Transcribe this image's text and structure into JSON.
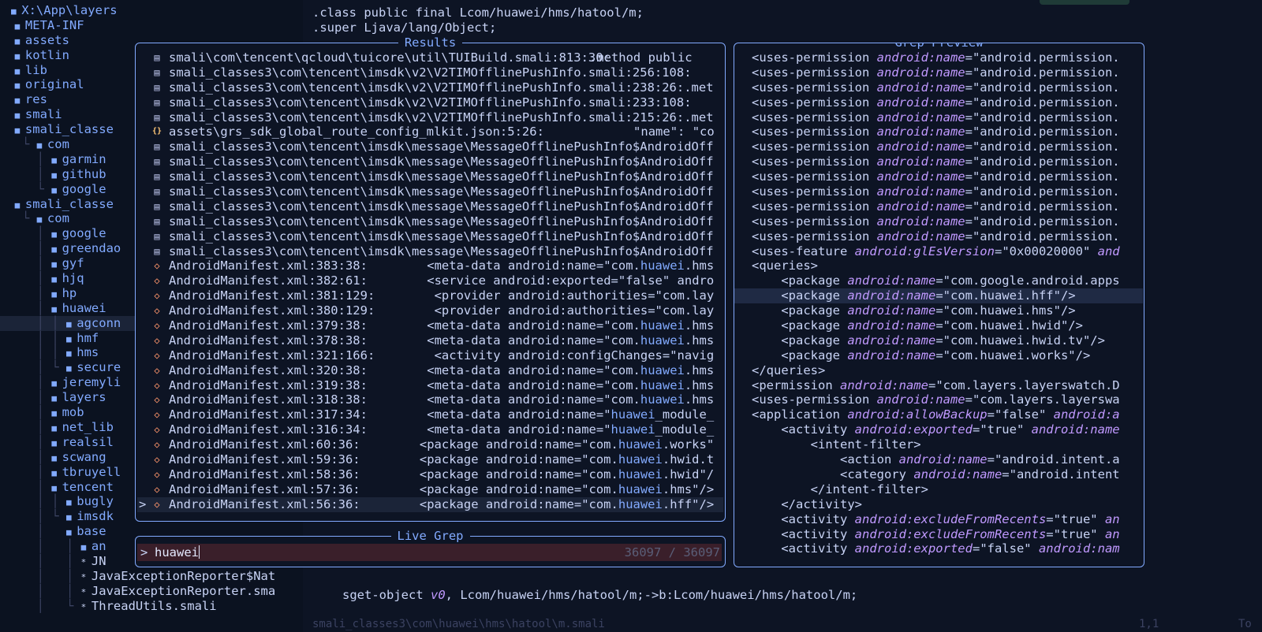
{
  "tree": {
    "items": [
      {
        "indent": "",
        "guide": "",
        "icon": "dir",
        "label": "X:\\App\\layers",
        "fold": ""
      },
      {
        "indent": "  ",
        "guide": "",
        "icon": "dir",
        "label": "META-INF"
      },
      {
        "indent": "  ",
        "guide": "",
        "icon": "dir",
        "label": "assets"
      },
      {
        "indent": "  ",
        "guide": "",
        "icon": "dir",
        "label": "kotlin"
      },
      {
        "indent": "  ",
        "guide": "",
        "icon": "dir",
        "label": "lib"
      },
      {
        "indent": "  ",
        "guide": "",
        "icon": "dir",
        "label": "original"
      },
      {
        "indent": "  ",
        "guide": "",
        "icon": "dir",
        "label": "res"
      },
      {
        "indent": "  ",
        "guide": "",
        "icon": "dir",
        "label": "smali"
      },
      {
        "indent": "  ",
        "guide": "",
        "icon": "dir",
        "label": "smali_classe"
      },
      {
        "indent": "   ",
        "guide": "└ ",
        "icon": "dir",
        "label": "com"
      },
      {
        "indent": "     ",
        "guide": "│ ",
        "icon": "dir",
        "label": "garmin"
      },
      {
        "indent": "     ",
        "guide": "│ ",
        "icon": "dir",
        "label": "github"
      },
      {
        "indent": "     ",
        "guide": "└ ",
        "icon": "dir",
        "label": "google"
      },
      {
        "indent": "  ",
        "guide": "",
        "icon": "dir",
        "label": "smali_classe"
      },
      {
        "indent": "   ",
        "guide": "└ ",
        "icon": "dir",
        "label": "com"
      },
      {
        "indent": "     ",
        "guide": "│ ",
        "icon": "dir",
        "label": "google"
      },
      {
        "indent": "     ",
        "guide": "│ ",
        "icon": "dir",
        "label": "greendao"
      },
      {
        "indent": "     ",
        "guide": "│ ",
        "icon": "dir",
        "label": "gyf"
      },
      {
        "indent": "     ",
        "guide": "│ ",
        "icon": "dir",
        "label": "hjq"
      },
      {
        "indent": "     ",
        "guide": "│ ",
        "icon": "dir",
        "label": "hp"
      },
      {
        "indent": "     ",
        "guide": "│ ",
        "icon": "dir",
        "label": "huawei"
      },
      {
        "indent": "     ",
        "guide": "│ │ ",
        "icon": "dir",
        "label": "agconn",
        "selected": true
      },
      {
        "indent": "     ",
        "guide": "│ │ ",
        "icon": "dir",
        "label": "hmf"
      },
      {
        "indent": "     ",
        "guide": "│ │ ",
        "icon": "dir",
        "label": "hms"
      },
      {
        "indent": "     ",
        "guide": "│ └ ",
        "icon": "dir",
        "label": "secure"
      },
      {
        "indent": "     ",
        "guide": "│ ",
        "icon": "dir",
        "label": "jeremyli"
      },
      {
        "indent": "     ",
        "guide": "│ ",
        "icon": "dir",
        "label": "layers"
      },
      {
        "indent": "     ",
        "guide": "│ ",
        "icon": "dir",
        "label": "mob"
      },
      {
        "indent": "     ",
        "guide": "│ ",
        "icon": "dir",
        "label": "net_lib"
      },
      {
        "indent": "     ",
        "guide": "│ ",
        "icon": "dir",
        "label": "realsil"
      },
      {
        "indent": "     ",
        "guide": "│ ",
        "icon": "dir",
        "label": "scwang"
      },
      {
        "indent": "     ",
        "guide": "│ ",
        "icon": "dir",
        "label": "tbruyell"
      },
      {
        "indent": "     ",
        "guide": "│ ",
        "icon": "dir",
        "label": "tencent"
      },
      {
        "indent": "     ",
        "guide": "│ │ ",
        "icon": "dir",
        "label": "bugly"
      },
      {
        "indent": "     ",
        "guide": "│ └ ",
        "icon": "dir",
        "label": "imsdk"
      },
      {
        "indent": "     ",
        "guide": "│   ",
        "icon": "dir",
        "label": "base"
      },
      {
        "indent": "     ",
        "guide": "│   │ ",
        "icon": "dir",
        "label": "an"
      },
      {
        "indent": "     ",
        "guide": "│   │ ",
        "icon": "file",
        "label": "JN"
      },
      {
        "indent": "     ",
        "guide": "│   │ ",
        "icon": "file",
        "label": "JavaExceptionReporter$Nat"
      },
      {
        "indent": "     ",
        "guide": "│   │ ",
        "icon": "file",
        "label": "JavaExceptionReporter.sma"
      },
      {
        "indent": "     ",
        "guide": "│   └ ",
        "icon": "file",
        "label": "ThreadUtils.smali"
      }
    ]
  },
  "editor": {
    "line1_a": ".class public final ",
    "line1_b": "Lcom/huawei/hms/hatool/m;",
    "line2_a": ".super ",
    "line2_b": "Ljava/lang/Object;",
    "code_a": "sget-object ",
    "code_reg": "v0",
    "code_b": ", Lcom/huawei/hms/hatool/m;->b:Lcom/huawei/hms/hatool/m;",
    "status_file": "smali_classes3\\com\\huawei\\hms\\hatool\\m.smali",
    "status_pos": "1,1",
    "status_extra": "To"
  },
  "results": {
    "title": "Results",
    "rows": [
      {
        "icon": "file",
        "path": "smali\\com\\tencent\\qcloud\\tuicore\\util\\TUIBuild.smali:813:30:",
        "pre": ".method public",
        "hl": "",
        "post": "",
        "textcol": 57
      },
      {
        "icon": "file",
        "path": "smali_classes3\\com\\tencent\\imsdk\\v2\\V2TIMOfflinePushInfo.smali:256:108:",
        "pre": "",
        "hl": "",
        "post": "",
        "textcol": 0
      },
      {
        "icon": "file",
        "path": "smali_classes3\\com\\tencent\\imsdk\\v2\\V2TIMOfflinePushInfo.smali:238:26:.met",
        "pre": "",
        "hl": "",
        "post": "",
        "textcol": 0
      },
      {
        "icon": "file",
        "path": "smali_classes3\\com\\tencent\\imsdk\\v2\\V2TIMOfflinePushInfo.smali:233:108:",
        "pre": "",
        "hl": "",
        "post": "",
        "textcol": 0
      },
      {
        "icon": "file",
        "path": "smali_classes3\\com\\tencent\\imsdk\\v2\\V2TIMOfflinePushInfo.smali:215:26:.met",
        "pre": "",
        "hl": "",
        "post": "",
        "textcol": 0
      },
      {
        "icon": "json",
        "path": "assets\\grs_sdk_global_route_config_mlkit.json:5:26:",
        "pre": "\"name\": \"co",
        "hl": "",
        "post": "",
        "textcol": 63
      },
      {
        "icon": "file",
        "path": "smali_classes3\\com\\tencent\\imsdk\\message\\MessageOfflinePushInfo$AndroidOff",
        "pre": "",
        "hl": "",
        "post": "",
        "textcol": 0
      },
      {
        "icon": "file",
        "path": "smali_classes3\\com\\tencent\\imsdk\\message\\MessageOfflinePushInfo$AndroidOff",
        "pre": "",
        "hl": "",
        "post": "",
        "textcol": 0
      },
      {
        "icon": "file",
        "path": "smali_classes3\\com\\tencent\\imsdk\\message\\MessageOfflinePushInfo$AndroidOff",
        "pre": "",
        "hl": "",
        "post": "",
        "textcol": 0
      },
      {
        "icon": "file",
        "path": "smali_classes3\\com\\tencent\\imsdk\\message\\MessageOfflinePushInfo$AndroidOff",
        "pre": "",
        "hl": "",
        "post": "",
        "textcol": 0
      },
      {
        "icon": "file",
        "path": "smali_classes3\\com\\tencent\\imsdk\\message\\MessageOfflinePushInfo$AndroidOff",
        "pre": "",
        "hl": "",
        "post": "",
        "textcol": 0
      },
      {
        "icon": "file",
        "path": "smali_classes3\\com\\tencent\\imsdk\\message\\MessageOfflinePushInfo$AndroidOff",
        "pre": "",
        "hl": "",
        "post": "",
        "textcol": 0
      },
      {
        "icon": "file",
        "path": "smali_classes3\\com\\tencent\\imsdk\\message\\MessageOfflinePushInfo$AndroidOff",
        "pre": "",
        "hl": "",
        "post": "",
        "textcol": 0
      },
      {
        "icon": "file",
        "path": "smali_classes3\\com\\tencent\\imsdk\\message\\MessageOfflinePushInfo$AndroidOff",
        "pre": "",
        "hl": "",
        "post": "",
        "textcol": 0
      },
      {
        "icon": "xml",
        "path": "AndroidManifest.xml:383:38:",
        "pre": "<meta-data android:name=\"com.",
        "hl": "huawei",
        "post": ".hms",
        "textcol": 35
      },
      {
        "icon": "xml",
        "path": "AndroidManifest.xml:382:61:",
        "pre": "<service android:exported=\"false\" andro",
        "hl": "",
        "post": "",
        "textcol": 35
      },
      {
        "icon": "xml",
        "path": "AndroidManifest.xml:381:129:",
        "pre": "<provider android:authorities=\"com.lay",
        "hl": "",
        "post": "",
        "textcol": 36
      },
      {
        "icon": "xml",
        "path": "AndroidManifest.xml:380:129:",
        "pre": "<provider android:authorities=\"com.lay",
        "hl": "",
        "post": "",
        "textcol": 36
      },
      {
        "icon": "xml",
        "path": "AndroidManifest.xml:379:38:",
        "pre": "<meta-data android:name=\"com.",
        "hl": "huawei",
        "post": ".hms",
        "textcol": 35
      },
      {
        "icon": "xml",
        "path": "AndroidManifest.xml:378:38:",
        "pre": "<meta-data android:name=\"com.",
        "hl": "huawei",
        "post": ".hms",
        "textcol": 35
      },
      {
        "icon": "xml",
        "path": "AndroidManifest.xml:321:166:",
        "pre": "<activity android:configChanges=\"navig",
        "hl": "",
        "post": "",
        "textcol": 36
      },
      {
        "icon": "xml",
        "path": "AndroidManifest.xml:320:38:",
        "pre": "<meta-data android:name=\"com.",
        "hl": "huawei",
        "post": ".hms",
        "textcol": 35
      },
      {
        "icon": "xml",
        "path": "AndroidManifest.xml:319:38:",
        "pre": "<meta-data android:name=\"com.",
        "hl": "huawei",
        "post": ".hms",
        "textcol": 35
      },
      {
        "icon": "xml",
        "path": "AndroidManifest.xml:318:38:",
        "pre": "<meta-data android:name=\"com.",
        "hl": "huawei",
        "post": ".hms",
        "textcol": 35
      },
      {
        "icon": "xml",
        "path": "AndroidManifest.xml:317:34:",
        "pre": "<meta-data android:name=\"",
        "hl": "huawei",
        "post": "_module_",
        "textcol": 35
      },
      {
        "icon": "xml",
        "path": "AndroidManifest.xml:316:34:",
        "pre": "<meta-data android:name=\"",
        "hl": "huawei",
        "post": "_module_",
        "textcol": 35
      },
      {
        "icon": "xml",
        "path": "AndroidManifest.xml:60:36:",
        "pre": "<package android:name=\"com.",
        "hl": "huawei",
        "post": ".works\"",
        "textcol": 34
      },
      {
        "icon": "xml",
        "path": "AndroidManifest.xml:59:36:",
        "pre": "<package android:name=\"com.",
        "hl": "huawei",
        "post": ".hwid.t",
        "textcol": 34
      },
      {
        "icon": "xml",
        "path": "AndroidManifest.xml:58:36:",
        "pre": "<package android:name=\"com.",
        "hl": "huawei",
        "post": ".hwid\"/",
        "textcol": 34
      },
      {
        "icon": "xml",
        "path": "AndroidManifest.xml:57:36:",
        "pre": "<package android:name=\"com.",
        "hl": "huawei",
        "post": ".hms\"/>",
        "textcol": 34
      },
      {
        "icon": "xml",
        "path": "AndroidManifest.xml:56:36:",
        "pre": "<package android:name=\"com.",
        "hl": "huawei",
        "post": ".hff\"/>",
        "textcol": 34,
        "active": true
      }
    ]
  },
  "livegrep": {
    "title": "Live Grep",
    "prompt": ">",
    "query": "huawei",
    "count": "36097 / 36097"
  },
  "preview": {
    "title": "Grep Preview",
    "lines": [
      {
        "ind": "",
        "tag": "<uses-permission ",
        "attr": "android:name",
        "eq": "=",
        "str": "\"android.permission."
      },
      {
        "ind": "",
        "tag": "<uses-permission ",
        "attr": "android:name",
        "eq": "=",
        "str": "\"android.permission."
      },
      {
        "ind": "",
        "tag": "<uses-permission ",
        "attr": "android:name",
        "eq": "=",
        "str": "\"android.permission."
      },
      {
        "ind": "",
        "tag": "<uses-permission ",
        "attr": "android:name",
        "eq": "=",
        "str": "\"android.permission."
      },
      {
        "ind": "",
        "tag": "<uses-permission ",
        "attr": "android:name",
        "eq": "=",
        "str": "\"android.permission."
      },
      {
        "ind": "",
        "tag": "<uses-permission ",
        "attr": "android:name",
        "eq": "=",
        "str": "\"android.permission."
      },
      {
        "ind": "",
        "tag": "<uses-permission ",
        "attr": "android:name",
        "eq": "=",
        "str": "\"android.permission."
      },
      {
        "ind": "",
        "tag": "<uses-permission ",
        "attr": "android:name",
        "eq": "=",
        "str": "\"android.permission."
      },
      {
        "ind": "",
        "tag": "<uses-permission ",
        "attr": "android:name",
        "eq": "=",
        "str": "\"android.permission."
      },
      {
        "ind": "",
        "tag": "<uses-permission ",
        "attr": "android:name",
        "eq": "=",
        "str": "\"android.permission."
      },
      {
        "ind": "",
        "tag": "<uses-permission ",
        "attr": "android:name",
        "eq": "=",
        "str": "\"android.permission."
      },
      {
        "ind": "",
        "tag": "<uses-permission ",
        "attr": "android:name",
        "eq": "=",
        "str": "\"android.permission."
      },
      {
        "ind": "",
        "tag": "<uses-permission ",
        "attr": "android:name",
        "eq": "=",
        "str": "\"android.permission."
      },
      {
        "ind": "",
        "tag": "<uses-feature ",
        "attr": "android:glEsVersion",
        "eq": "=",
        "str": "\"0x00020000\" ",
        "attr2": "and"
      },
      {
        "ind": "",
        "tag": "<queries>",
        "attr": "",
        "eq": "",
        "str": ""
      },
      {
        "ind": "    ",
        "tag": "<package ",
        "attr": "android:name",
        "eq": "=",
        "str": "\"com.google.android.apps"
      },
      {
        "ind": "    ",
        "tag": "<package ",
        "attr": "android:name",
        "eq": "=",
        "str": "\"com.huawei.hff\"/>",
        "cur": true
      },
      {
        "ind": "    ",
        "tag": "<package ",
        "attr": "android:name",
        "eq": "=",
        "str": "\"com.huawei.hms\"/>"
      },
      {
        "ind": "    ",
        "tag": "<package ",
        "attr": "android:name",
        "eq": "=",
        "str": "\"com.huawei.hwid\"/>"
      },
      {
        "ind": "    ",
        "tag": "<package ",
        "attr": "android:name",
        "eq": "=",
        "str": "\"com.huawei.hwid.tv\"/>"
      },
      {
        "ind": "    ",
        "tag": "<package ",
        "attr": "android:name",
        "eq": "=",
        "str": "\"com.huawei.works\"/>"
      },
      {
        "ind": "",
        "tag": "</queries>",
        "attr": "",
        "eq": "",
        "str": ""
      },
      {
        "ind": "",
        "tag": "<permission ",
        "attr": "android:name",
        "eq": "=",
        "str": "\"com.layers.layerswatch.D"
      },
      {
        "ind": "",
        "tag": "<uses-permission ",
        "attr": "android:name",
        "eq": "=",
        "str": "\"com.layers.layerswa"
      },
      {
        "ind": "",
        "tag": "<application ",
        "attr": "android:allowBackup",
        "eq": "=",
        "str": "\"false\" ",
        "attr2": "android:a"
      },
      {
        "ind": "    ",
        "tag": "<activity ",
        "attr": "android:exported",
        "eq": "=",
        "str": "\"true\" ",
        "attr2": "android:name"
      },
      {
        "ind": "        ",
        "tag": "<intent-filter>",
        "attr": "",
        "eq": "",
        "str": ""
      },
      {
        "ind": "            ",
        "tag": "<action ",
        "attr": "android:name",
        "eq": "=",
        "str": "\"android.intent.a"
      },
      {
        "ind": "            ",
        "tag": "<category ",
        "attr": "android:name",
        "eq": "=",
        "str": "\"android.intent"
      },
      {
        "ind": "        ",
        "tag": "</intent-filter>",
        "attr": "",
        "eq": "",
        "str": ""
      },
      {
        "ind": "    ",
        "tag": "</activity>",
        "attr": "",
        "eq": "",
        "str": ""
      },
      {
        "ind": "    ",
        "tag": "<activity ",
        "attr": "android:excludeFromRecents",
        "eq": "=",
        "str": "\"true\" ",
        "attr2": "an"
      },
      {
        "ind": "    ",
        "tag": "<activity ",
        "attr": "android:excludeFromRecents",
        "eq": "=",
        "str": "\"true\" ",
        "attr2": "an"
      },
      {
        "ind": "    ",
        "tag": "<activity ",
        "attr": "android:exported",
        "eq": "=",
        "str": "\"false\" ",
        "attr2": "android:nam"
      }
    ]
  },
  "icons": {
    "dir": "folder-icon",
    "file": "file-icon",
    "json": "json-file-icon",
    "xml": "xml-file-icon"
  },
  "colors": {
    "accent": "#82aaff",
    "attr": "#c099ff",
    "xml_icon": "#ff966c",
    "json_icon": "#ffc777",
    "livegrep_bg": "#3a1f2a"
  }
}
